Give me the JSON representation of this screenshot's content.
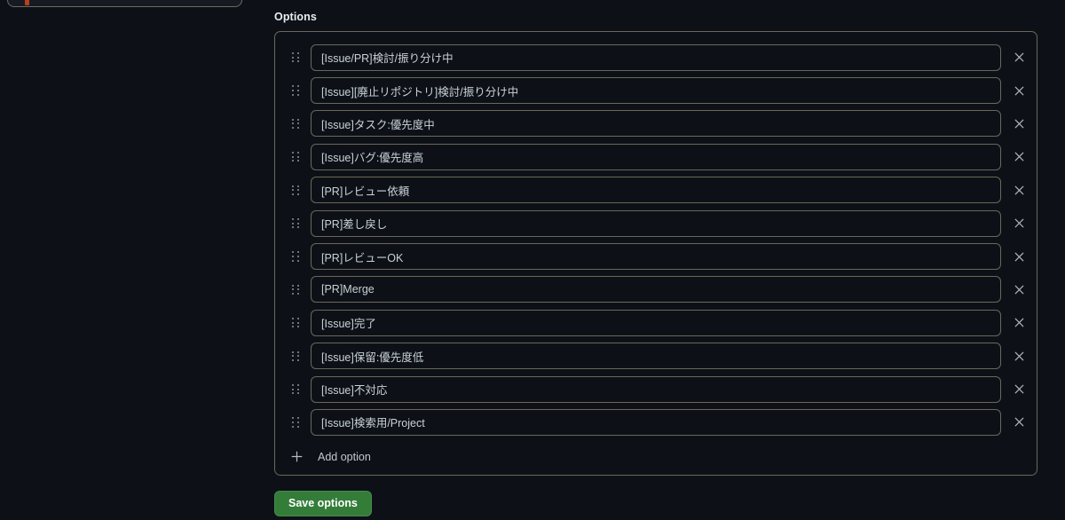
{
  "left_panel": {
    "accent_color": "#b5401f",
    "border_color": "#6e6a5f"
  },
  "options_section": {
    "label": "Options",
    "container_border_color": "#6b6758",
    "options": [
      {
        "value": "[Issue/PR]検討/振り分け中",
        "remove_icon": "close-icon"
      },
      {
        "value": "[Issue][廃止リポジトリ]検討/振り分け中",
        "remove_icon": "close-icon"
      },
      {
        "value": "[Issue]タスク:優先度中",
        "remove_icon": "close-icon"
      },
      {
        "value": "[Issue]バグ:優先度高",
        "remove_icon": "close-icon"
      },
      {
        "value": "[PR]レビュー依頼",
        "remove_icon": "close-icon"
      },
      {
        "value": "[PR]差し戻し",
        "remove_icon": "close-icon"
      },
      {
        "value": "[PR]レビューOK",
        "remove_icon": "close-icon"
      },
      {
        "value": "[PR]Merge",
        "remove_icon": "close-icon"
      },
      {
        "value": "[Issue]完了",
        "remove_icon": "close-icon"
      },
      {
        "value": "[Issue]保留:優先度低",
        "remove_icon": "close-icon"
      },
      {
        "value": "[Issue]不対応",
        "remove_icon": "close-icon"
      },
      {
        "value": "[Issue]検索用/Project",
        "remove_icon": "close-icon"
      }
    ],
    "add_option": {
      "label": "Add option",
      "icon": "plus-icon"
    },
    "drag_handle_icon": "drag-handle-icon"
  },
  "footer": {
    "save_label": "Save options",
    "save_color": "#347d39"
  }
}
